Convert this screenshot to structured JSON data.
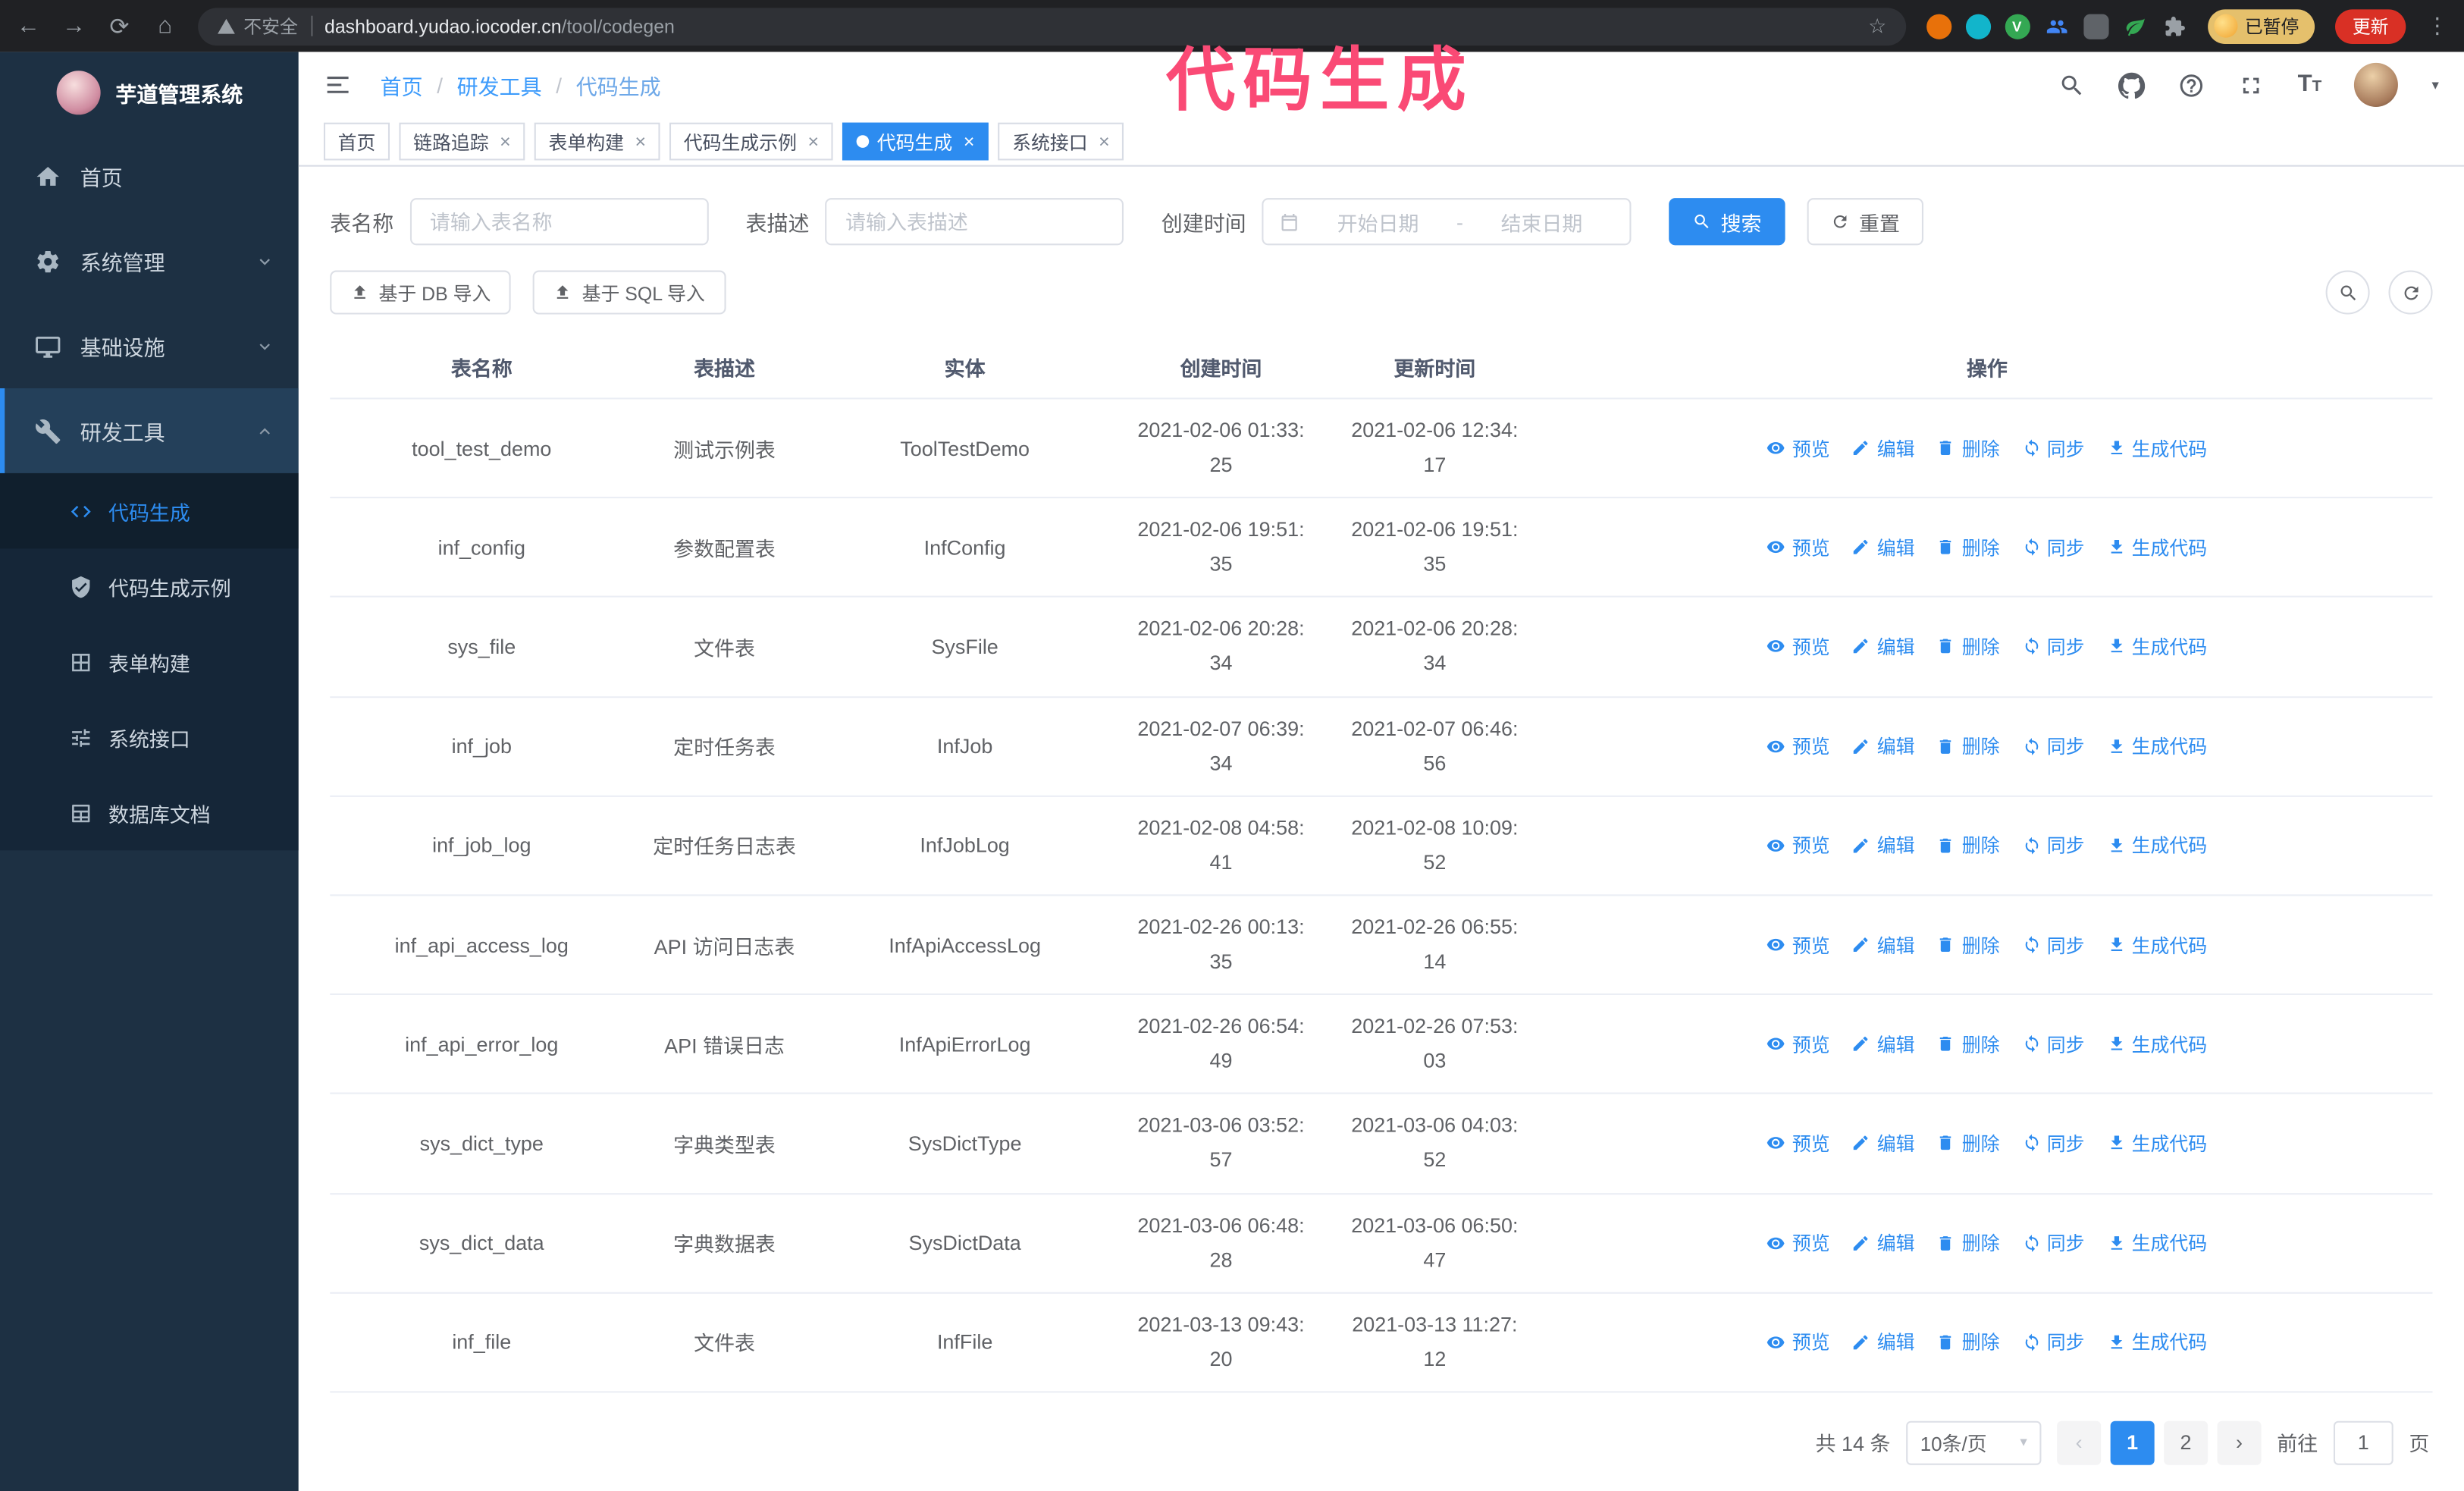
{
  "colors": {
    "accent": "#2d8cf0",
    "sidebar_bg": "#1d3043",
    "annotation": "#fa4a75",
    "update_button_bg": "#d93025"
  },
  "browser": {
    "security_label": "不安全",
    "url_host": "dashboard.yudao.iocoder.cn",
    "url_path": "/tool/codegen",
    "paused_badge": "已暂停",
    "update_button": "更新"
  },
  "annotation": {
    "title": "代码生成"
  },
  "sidebar": {
    "logo_title": "芋道管理系统",
    "items": [
      {
        "key": "home",
        "label": "首页",
        "icon": "home"
      },
      {
        "key": "system",
        "label": "系统管理",
        "icon": "gear",
        "expandable": true
      },
      {
        "key": "infra",
        "label": "基础设施",
        "icon": "monitor",
        "expandable": true
      },
      {
        "key": "devtools",
        "label": "研发工具",
        "icon": "tools",
        "expandable": true,
        "expanded": true
      }
    ],
    "sub_items": [
      {
        "key": "codegen",
        "label": "代码生成",
        "icon": "code",
        "active": true
      },
      {
        "key": "codegen-example",
        "label": "代码生成示例",
        "icon": "shield"
      },
      {
        "key": "form-builder",
        "label": "表单构建",
        "icon": "grid"
      },
      {
        "key": "system-api",
        "label": "系统接口",
        "icon": "sliders"
      },
      {
        "key": "db-doc",
        "label": "数据库文档",
        "icon": "db"
      }
    ]
  },
  "breadcrumb": [
    "首页",
    "研发工具",
    "代码生成"
  ],
  "tabs": [
    {
      "label": "首页",
      "closable": false
    },
    {
      "label": "链路追踪",
      "closable": true
    },
    {
      "label": "表单构建",
      "closable": true
    },
    {
      "label": "代码生成示例",
      "closable": true
    },
    {
      "label": "代码生成",
      "closable": true,
      "active": true
    },
    {
      "label": "系统接口",
      "closable": true
    }
  ],
  "filters": {
    "table_name_label": "表名称",
    "table_name_placeholder": "请输入表名称",
    "table_desc_label": "表描述",
    "table_desc_placeholder": "请输入表描述",
    "create_time_label": "创建时间",
    "date_start_placeholder": "开始日期",
    "date_separator": "-",
    "date_end_placeholder": "结束日期",
    "search_button": "搜索",
    "reset_button": "重置"
  },
  "toolbar": {
    "import_db": "基于 DB 导入",
    "import_sql": "基于 SQL 导入"
  },
  "table": {
    "columns": [
      "表名称",
      "表描述",
      "实体",
      "创建时间",
      "更新时间",
      "操作"
    ],
    "actions": [
      "预览",
      "编辑",
      "删除",
      "同步",
      "生成代码"
    ],
    "rows": [
      {
        "name": "tool_test_demo",
        "desc": "测试示例表",
        "entity": "ToolTestDemo",
        "created": "2021-02-06 01:33:25",
        "updated": "2021-02-06 12:34:17"
      },
      {
        "name": "inf_config",
        "desc": "参数配置表",
        "entity": "InfConfig",
        "created": "2021-02-06 19:51:35",
        "updated": "2021-02-06 19:51:35"
      },
      {
        "name": "sys_file",
        "desc": "文件表",
        "entity": "SysFile",
        "created": "2021-02-06 20:28:34",
        "updated": "2021-02-06 20:28:34"
      },
      {
        "name": "inf_job",
        "desc": "定时任务表",
        "entity": "InfJob",
        "created": "2021-02-07 06:39:34",
        "updated": "2021-02-07 06:46:56"
      },
      {
        "name": "inf_job_log",
        "desc": "定时任务日志表",
        "entity": "InfJobLog",
        "created": "2021-02-08 04:58:41",
        "updated": "2021-02-08 10:09:52"
      },
      {
        "name": "inf_api_access_log",
        "desc": "API 访问日志表",
        "entity": "InfApiAccessLog",
        "created": "2021-02-26 00:13:35",
        "updated": "2021-02-26 06:55:14"
      },
      {
        "name": "inf_api_error_log",
        "desc": "API 错误日志",
        "entity": "InfApiErrorLog",
        "created": "2021-02-26 06:54:49",
        "updated": "2021-02-26 07:53:03"
      },
      {
        "name": "sys_dict_type",
        "desc": "字典类型表",
        "entity": "SysDictType",
        "created": "2021-03-06 03:52:57",
        "updated": "2021-03-06 04:03:52"
      },
      {
        "name": "sys_dict_data",
        "desc": "字典数据表",
        "entity": "SysDictData",
        "created": "2021-03-06 06:48:28",
        "updated": "2021-03-06 06:50:47"
      },
      {
        "name": "inf_file",
        "desc": "文件表",
        "entity": "InfFile",
        "created": "2021-03-13 09:43:20",
        "updated": "2021-03-13 11:27:12"
      }
    ]
  },
  "pagination": {
    "total": "共 14 条",
    "page_size": "10条/页",
    "pages": [
      "1",
      "2"
    ],
    "current": "1",
    "goto_label": "前往",
    "goto_value": "1",
    "unit": "页"
  }
}
